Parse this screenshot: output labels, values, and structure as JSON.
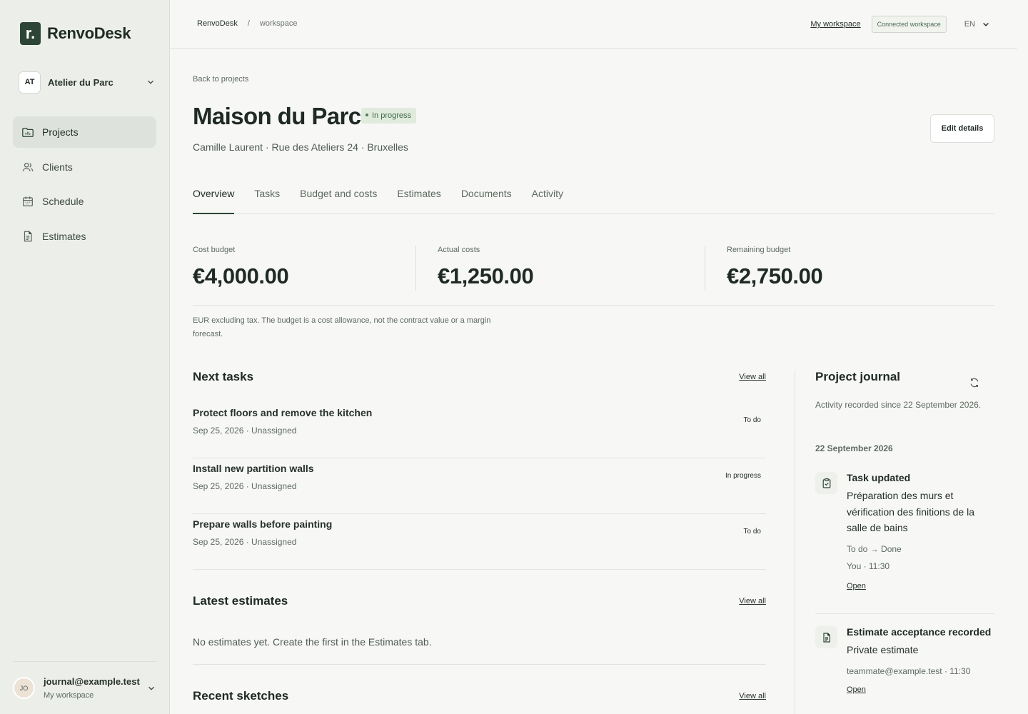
{
  "brand": {
    "logo_letter": "r.",
    "name": "RenvoDesk"
  },
  "org": {
    "initials": "AT",
    "name": "Atelier du Parc"
  },
  "nav": [
    {
      "label": "Projects",
      "icon": "folder-chart-icon",
      "active": true
    },
    {
      "label": "Clients",
      "icon": "users-icon"
    },
    {
      "label": "Schedule",
      "icon": "calendar-icon"
    },
    {
      "label": "Estimates",
      "icon": "document-icon"
    }
  ],
  "user": {
    "initials": "JO",
    "email": "journal@example.test",
    "workspace": "My workspace"
  },
  "topbar": {
    "crumb_root": "RenvoDesk",
    "crumb_sep": "/",
    "crumb_current": "workspace",
    "my_workspace": "My workspace",
    "connected_badge": "Connected workspace",
    "lang": "EN"
  },
  "project": {
    "back": "Back to projects",
    "title": "Maison du Parc",
    "status": "In progress",
    "subtitle": "Camille Laurent · Rue des Ateliers 24 · Bruxelles",
    "edit_label": "Edit details"
  },
  "tabs": [
    "Overview",
    "Tasks",
    "Budget and costs",
    "Estimates",
    "Documents",
    "Activity"
  ],
  "metrics": [
    {
      "label": "Cost budget",
      "value": "€4,000.00"
    },
    {
      "label": "Actual costs",
      "value": "€1,250.00"
    },
    {
      "label": "Remaining budget",
      "value": "€2,750.00"
    }
  ],
  "budget_note": "EUR excluding tax. The budget is a cost allowance, not the contract value or a margin forecast.",
  "next_tasks": {
    "title": "Next tasks",
    "view_all": "View all",
    "items": [
      {
        "name": "Protect floors and remove the kitchen",
        "meta": "Sep 25, 2026 · Unassigned",
        "status": "To do"
      },
      {
        "name": "Install new partition walls",
        "meta": "Sep 25, 2026 · Unassigned",
        "status": "In progress"
      },
      {
        "name": "Prepare walls before painting",
        "meta": "Sep 25, 2026 · Unassigned",
        "status": "To do"
      }
    ]
  },
  "latest_estimates": {
    "title": "Latest estimates",
    "view_all": "View all",
    "empty": "No estimates yet. Create the first in the Estimates tab."
  },
  "recent_sketches": {
    "title": "Recent sketches",
    "view_all": "View all"
  },
  "journal": {
    "title": "Project journal",
    "subtitle": "Activity recorded since 22 September 2026.",
    "date": "22 September 2026",
    "entries": [
      {
        "icon": "clipboard-check-icon",
        "title": "Task updated",
        "body": "Préparation des murs et vérification des finitions de la salle de bains",
        "change": "To do → Done",
        "meta": "You · 11:30",
        "open": "Open"
      },
      {
        "icon": "document-icon",
        "title": "Estimate acceptance recorded",
        "body": "Private estimate",
        "meta": "teammate@example.test · 11:30",
        "open": "Open"
      }
    ]
  },
  "colors": {
    "accent": "#2d4536",
    "status_bg": "#e0ebdd",
    "status_text": "#3d6a48",
    "sidebar_bg": "#eceeea"
  }
}
